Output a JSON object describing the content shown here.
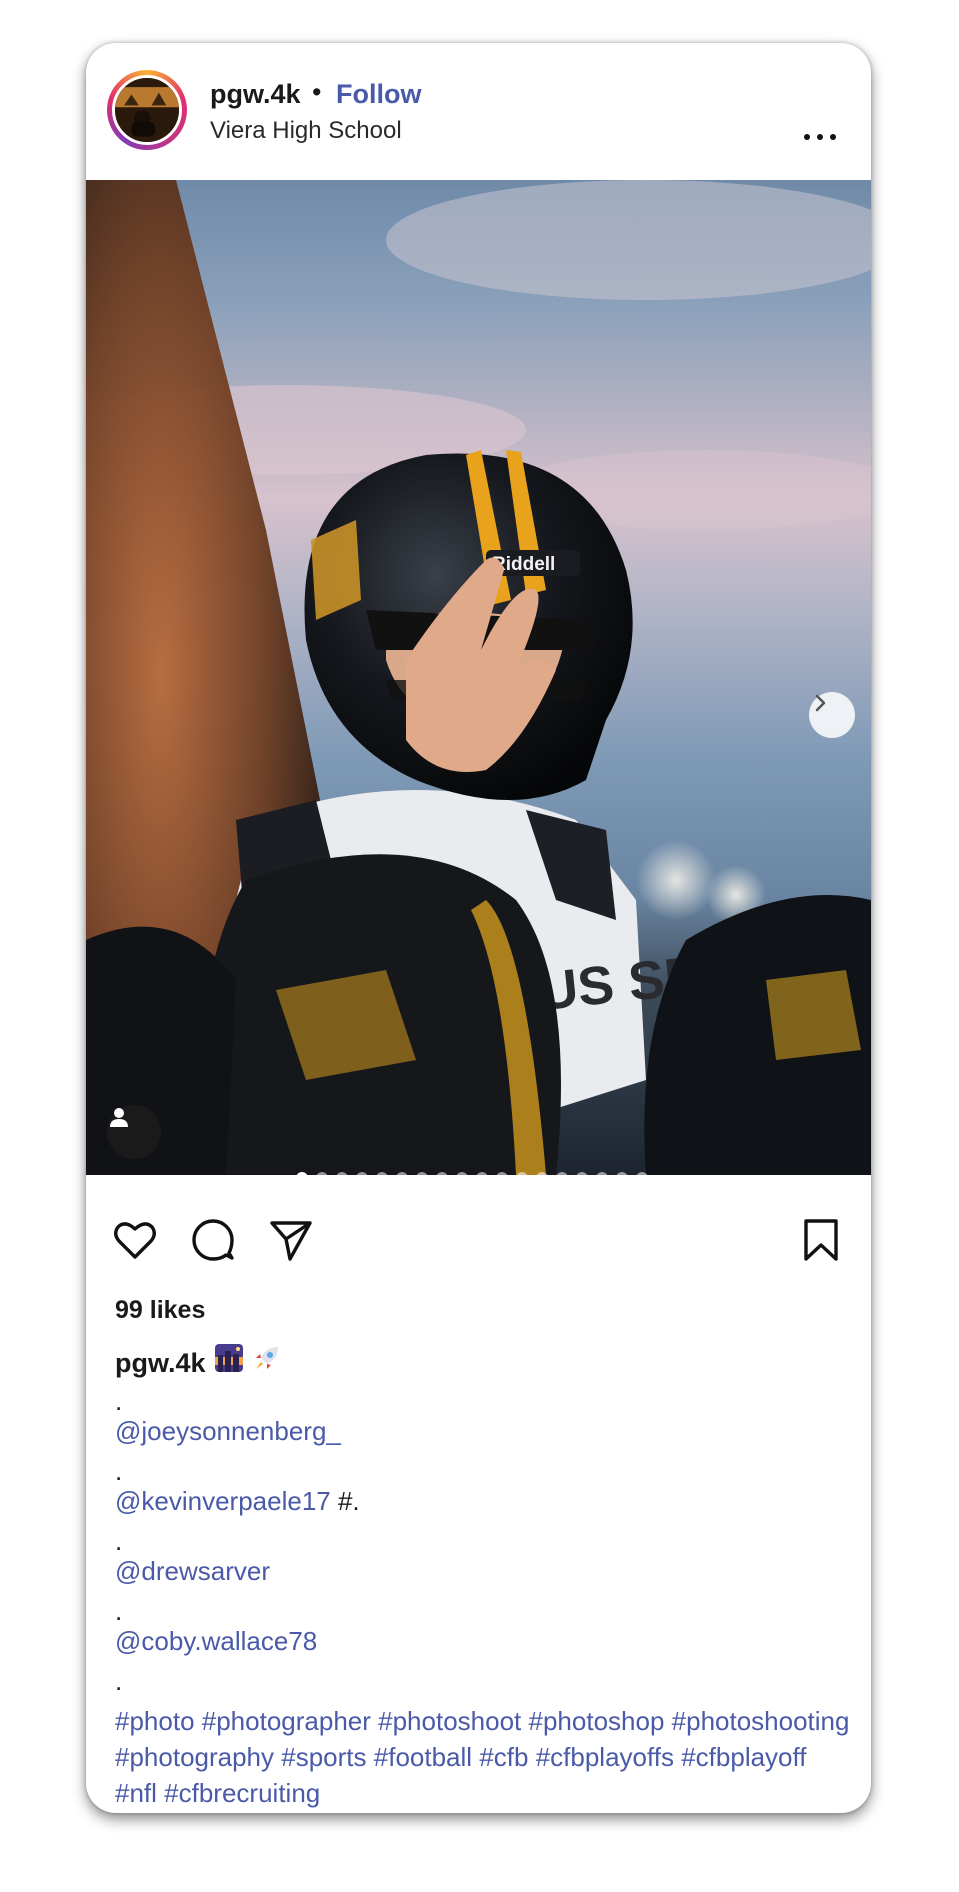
{
  "header": {
    "username": "pgw.4k",
    "separator": "•",
    "follow_label": "Follow",
    "location": "Viera High School"
  },
  "carousel": {
    "slide_count": 18,
    "active_index": 0,
    "helmet_brand": "Riddell",
    "jersey_text": "US SPA"
  },
  "engagement": {
    "likes_text": "99 likes"
  },
  "caption": {
    "username": "pgw.4k",
    "separator_1": ".",
    "mention_1": "@joeysonnenberg_",
    "separator_2": ".",
    "mention_2": "@kevinverpaele17",
    "mention_2_suffix": " #.",
    "separator_3": ".",
    "mention_3": "@drewsarver",
    "separator_4": ".",
    "mention_4": "@coby.wallace78",
    "separator_5": ".",
    "hashtags": [
      "#photo",
      "#photographer",
      "#photoshoot",
      "#photoshop",
      "#photoshooting",
      "#photography",
      "#sports",
      "#football",
      "#cfb",
      "#cfbplayoffs",
      "#cfbplayoff",
      "#nfl",
      "#cfbrecruiting"
    ]
  },
  "icons": {
    "more": "more-horizontal-icon",
    "next": "chevron-right-icon",
    "tag": "user-tag-icon",
    "like": "heart-icon",
    "comment": "comment-icon",
    "share": "send-icon",
    "save": "bookmark-icon",
    "emoji_1": "night-city-emoji",
    "emoji_2": "rocket-emoji"
  },
  "colors": {
    "link": "#4a5aa8",
    "text": "#1a1a1a",
    "helmet_stripe": "#e8a21c"
  }
}
